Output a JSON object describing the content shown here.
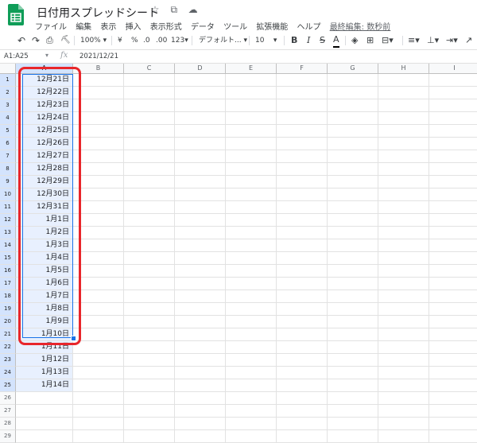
{
  "header": {
    "title": "日付用スプレッドシート",
    "star_icon": "☆",
    "folder_icon": "⧉",
    "cloud_icon": "☁",
    "logo_color": "#0f9d58"
  },
  "menu": {
    "items": [
      "ファイル",
      "編集",
      "表示",
      "挿入",
      "表示形式",
      "データ",
      "ツール",
      "拡張機能",
      "ヘルプ"
    ],
    "last_edit": "最終編集: 数秒前"
  },
  "toolbar": {
    "undo": "↶",
    "redo": "↷",
    "print": "⎙",
    "paint_format": "⛏",
    "zoom": "100%",
    "currency": "¥",
    "percent": "%",
    "decimal_decrease": ".0",
    "decimal_increase": ".00",
    "more_formats": "123",
    "font": "デフォルト...",
    "font_size": "10",
    "bold": "B",
    "italic": "I",
    "strikethrough": "S",
    "text_color": "A",
    "fill_color": "◈",
    "borders": "⊞",
    "merge": "⊟",
    "halign": "≡",
    "valign": "⊥",
    "wrap": "⇥",
    "rotate": "↗"
  },
  "formula_bar": {
    "name_box": "A1:A25",
    "fx": "fx",
    "value": "2021/12/21"
  },
  "sheet": {
    "columns": [
      "A",
      "B",
      "C",
      "D",
      "E",
      "F",
      "G",
      "H",
      "I"
    ],
    "rows": [
      "1",
      "2",
      "3",
      "4",
      "5",
      "6",
      "7",
      "8",
      "9",
      "10",
      "11",
      "12",
      "13",
      "14",
      "15",
      "16",
      "17",
      "18",
      "19",
      "20",
      "21",
      "22",
      "23",
      "24",
      "25",
      "26",
      "27",
      "28",
      "29"
    ],
    "column_a_values": [
      "12月21日",
      "12月22日",
      "12月23日",
      "12月24日",
      "12月25日",
      "12月26日",
      "12月27日",
      "12月28日",
      "12月29日",
      "12月30日",
      "12月31日",
      "1月1日",
      "1月2日",
      "1月3日",
      "1月4日",
      "1月5日",
      "1月6日",
      "1月7日",
      "1月8日",
      "1月9日",
      "1月10日",
      "1月11日",
      "1月12日",
      "1月13日",
      "1月14日",
      "",
      "",
      "",
      ""
    ],
    "selected_range": "A1:A25",
    "highlight_color": "#e8262b",
    "selection_color": "#1a73e8"
  }
}
